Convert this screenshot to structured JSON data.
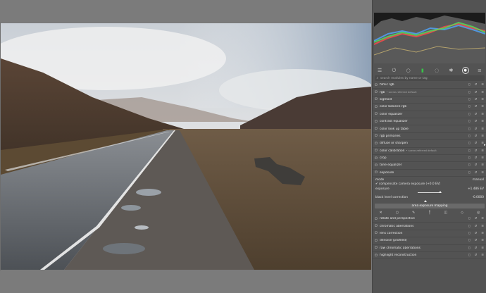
{
  "search": {
    "placeholder": "search modules by name or tag"
  },
  "tabs": [
    {
      "icon": "sliders-icon"
    },
    {
      "icon": "power-icon"
    },
    {
      "icon": "circle-icon"
    },
    {
      "icon": "color-module-icon"
    },
    {
      "icon": "drop-icon"
    },
    {
      "icon": "gear-icon"
    },
    {
      "icon": "favorite-icon"
    },
    {
      "icon": "menu-icon"
    }
  ],
  "modules": [
    {
      "name": "filmic rgb",
      "sub": ""
    },
    {
      "name": "rgb",
      "sub": "• scene-referred default"
    },
    {
      "name": "sigmoid",
      "sub": ""
    },
    {
      "name": "color balance rgb",
      "sub": ""
    },
    {
      "name": "color equalizer",
      "sub": ""
    },
    {
      "name": "contrast equalizer",
      "sub": ""
    },
    {
      "name": "color look up table",
      "sub": ""
    },
    {
      "name": "rgb primaries",
      "sub": ""
    },
    {
      "name": "diffuse or sharpen",
      "sub": ""
    },
    {
      "name": "color calibration",
      "sub": "• scene-referred default"
    },
    {
      "name": "crop",
      "sub": ""
    },
    {
      "name": "tone equalizer",
      "sub": ""
    },
    {
      "name": "exposure",
      "sub": ""
    }
  ],
  "exposure": {
    "mode_label": "mode",
    "mode_value": "manual",
    "compensate_label": "compensate camera exposure (+0.0 EV)",
    "exposure_label": "exposure",
    "exposure_value": "+1.486 EV",
    "blc_label": "black level correction",
    "blc_value": "-0.0000",
    "section_button": "area exposure mapping"
  },
  "modules_after": [
    {
      "name": "rotate and perspective"
    },
    {
      "name": "chromatic aberrations"
    },
    {
      "name": "lens correction"
    },
    {
      "name": "denoise (profiled)"
    },
    {
      "name": "raw chromatic aberrations"
    },
    {
      "name": "highlight reconstruction"
    }
  ],
  "colors": {
    "panel_bg": "#535353",
    "surround": "#7a7a7a",
    "active_green": "#39c24a"
  }
}
